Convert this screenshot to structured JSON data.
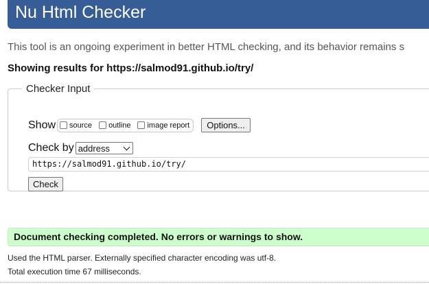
{
  "header": {
    "title": "Nu Html Checker"
  },
  "intro": "This tool is an ongoing experiment in better HTML checking, and its behavior remains s",
  "results_heading": "Showing results for https://salmod91.github.io/try/",
  "checker_input": {
    "legend": "Checker Input",
    "show_label": "Show",
    "show_options": [
      {
        "label": "source",
        "checked": false
      },
      {
        "label": "outline",
        "checked": false
      },
      {
        "label": "image report",
        "checked": false
      }
    ],
    "options_button": "Options...",
    "check_by_label": "Check by",
    "check_by_selected": "address",
    "url_value": "https://salmod91.github.io/try/",
    "check_button": "Check"
  },
  "result": {
    "success_message": "Document checking completed. No errors or warnings to show.",
    "parser_info": "Used the HTML parser. Externally specified character encoding was utf-8.",
    "time_info": "Total execution time 67 milliseconds."
  },
  "colors": {
    "header_bg": "#365d95",
    "success_bg": "#ccffcc"
  }
}
